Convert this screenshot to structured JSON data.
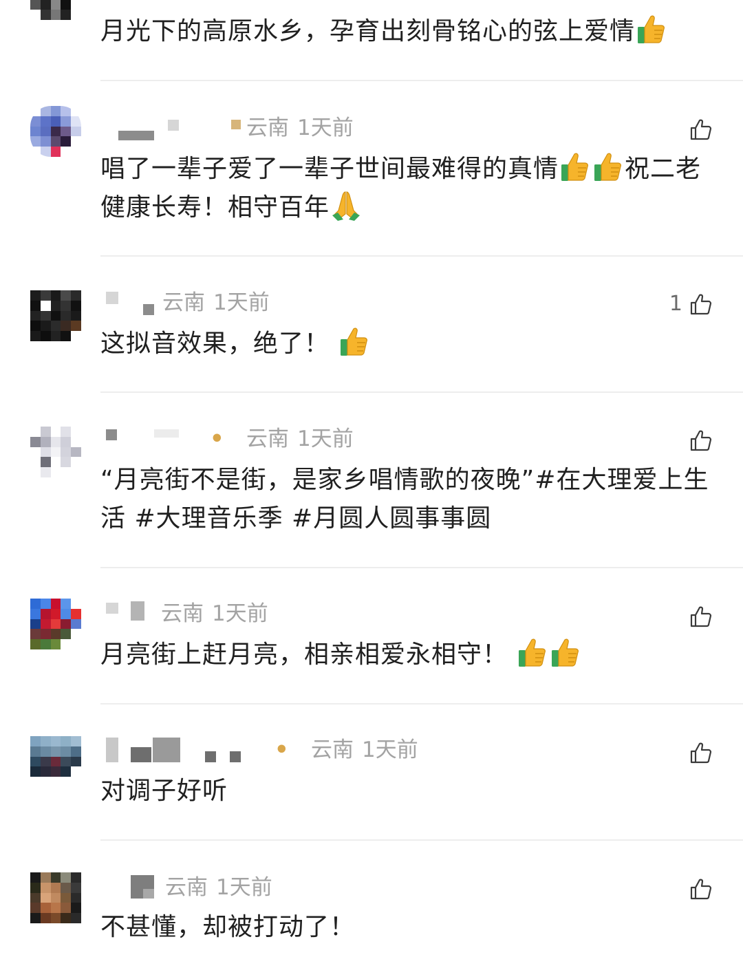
{
  "comments": [
    {
      "location": "",
      "time": "",
      "likes": "",
      "text_before": "月光下的高原水乡，孕育出刻骨铭心的弦上爱情",
      "text_after": "",
      "emojis": [
        "thumbs-up"
      ]
    },
    {
      "location": "云南",
      "time": "1天前",
      "likes": "",
      "text_before": "唱了一辈子爱了一辈子世间最难得的真情",
      "text_mid": "祝二老健康长寿！相守百年",
      "emojis_mid": [
        "thumbs-up",
        "thumbs-up"
      ],
      "emojis_end": [
        "folded-hands"
      ]
    },
    {
      "location": "云南",
      "time": "1天前",
      "likes": "1",
      "text_before": "这拟音效果，绝了！",
      "emojis": [
        "thumbs-up"
      ]
    },
    {
      "location": "云南",
      "time": "1天前",
      "likes": "",
      "badge": "ꔷ",
      "text_before": "“月亮街不是街，是家乡唱情歌的夜晚”#在大理爱上生活 #大理音乐季 #月圆人圆事事圆"
    },
    {
      "location": "云南",
      "time": "1天前",
      "likes": "",
      "text_before": "月亮街上赶月亮，相亲相爱永相守！",
      "emojis": [
        "thumbs-up",
        "thumbs-up"
      ]
    },
    {
      "location": "云南",
      "time": "1天前",
      "likes": "",
      "badge": "ꔷ",
      "text_before": "对调子好听"
    },
    {
      "location": "云南",
      "time": "1天前",
      "likes": "",
      "text_before": "不甚懂，却被打动了！"
    }
  ],
  "icons": {
    "like": "thumbs-up-outline-icon"
  },
  "colors": {
    "meta": "#a3a3a3",
    "text": "#202020",
    "divider": "#ededed",
    "badge": "#d9a64a"
  }
}
